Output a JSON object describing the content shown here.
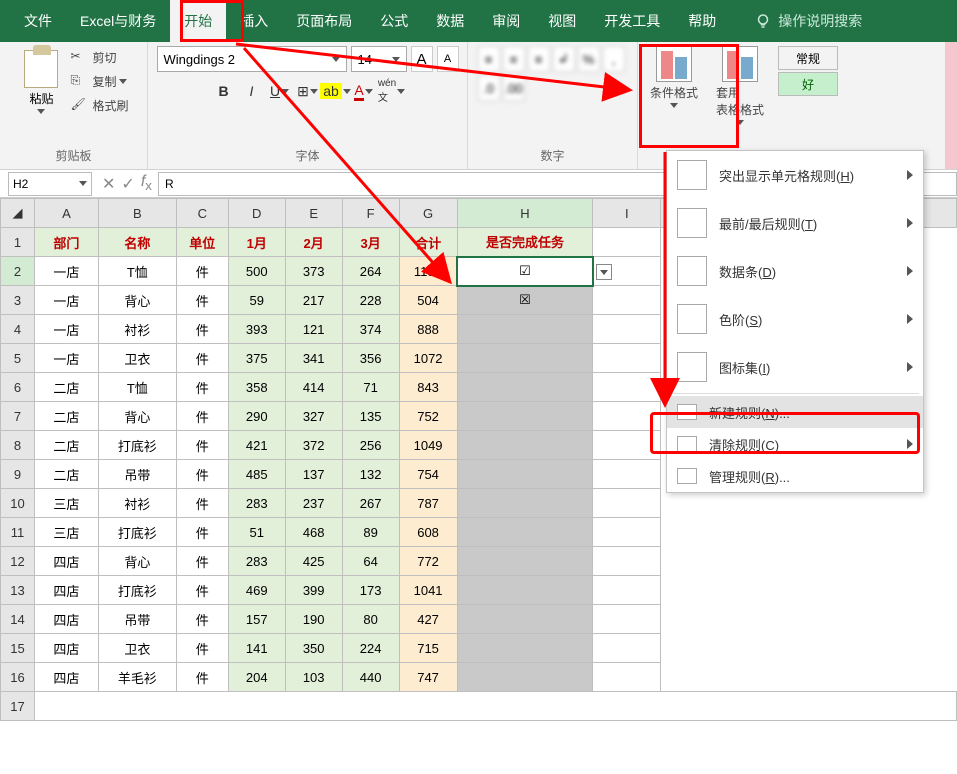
{
  "tabs": [
    "文件",
    "Excel与财务",
    "开始",
    "插入",
    "页面布局",
    "公式",
    "数据",
    "审阅",
    "视图",
    "开发工具",
    "帮助"
  ],
  "activeTab": 2,
  "search": "操作说明搜索",
  "clipboard": {
    "paste": "粘贴",
    "cut": "剪切",
    "copy": "复制",
    "format": "格式刷",
    "group": "剪贴板"
  },
  "font": {
    "group": "字体",
    "name": "Wingdings 2",
    "size": "14",
    "incA": "A",
    "decA": "A"
  },
  "number": {
    "group": "数字"
  },
  "condfmt": {
    "label1": "条件格式",
    "label2": "套用\n表格格式"
  },
  "styles": {
    "s1": "常规",
    "s2": "好"
  },
  "fx": {
    "namebox": "H2",
    "value": "R"
  },
  "columns": [
    "A",
    "B",
    "C",
    "D",
    "E",
    "F",
    "G",
    "H",
    "I"
  ],
  "headers": [
    "部门",
    "名称",
    "单位",
    "1月",
    "2月",
    "3月",
    "合计",
    "是否完成任务"
  ],
  "rows": [
    {
      "r": 2,
      "c": [
        "一店",
        "T恤",
        "件",
        "500",
        "373",
        "264",
        "1137",
        "☑"
      ]
    },
    {
      "r": 3,
      "c": [
        "一店",
        "背心",
        "件",
        "59",
        "217",
        "228",
        "504",
        "☒"
      ]
    },
    {
      "r": 4,
      "c": [
        "一店",
        "衬衫",
        "件",
        "393",
        "121",
        "374",
        "888",
        ""
      ]
    },
    {
      "r": 5,
      "c": [
        "一店",
        "卫衣",
        "件",
        "375",
        "341",
        "356",
        "1072",
        ""
      ]
    },
    {
      "r": 6,
      "c": [
        "二店",
        "T恤",
        "件",
        "358",
        "414",
        "71",
        "843",
        ""
      ]
    },
    {
      "r": 7,
      "c": [
        "二店",
        "背心",
        "件",
        "290",
        "327",
        "135",
        "752",
        ""
      ]
    },
    {
      "r": 8,
      "c": [
        "二店",
        "打底衫",
        "件",
        "421",
        "372",
        "256",
        "1049",
        ""
      ]
    },
    {
      "r": 9,
      "c": [
        "二店",
        "吊带",
        "件",
        "485",
        "137",
        "132",
        "754",
        ""
      ]
    },
    {
      "r": 10,
      "c": [
        "三店",
        "衬衫",
        "件",
        "283",
        "237",
        "267",
        "787",
        ""
      ]
    },
    {
      "r": 11,
      "c": [
        "三店",
        "打底衫",
        "件",
        "51",
        "468",
        "89",
        "608",
        ""
      ]
    },
    {
      "r": 12,
      "c": [
        "四店",
        "背心",
        "件",
        "283",
        "425",
        "64",
        "772",
        ""
      ]
    },
    {
      "r": 13,
      "c": [
        "四店",
        "打底衫",
        "件",
        "469",
        "399",
        "173",
        "1041",
        ""
      ]
    },
    {
      "r": 14,
      "c": [
        "四店",
        "吊带",
        "件",
        "157",
        "190",
        "80",
        "427",
        ""
      ]
    },
    {
      "r": 15,
      "c": [
        "四店",
        "卫衣",
        "件",
        "141",
        "350",
        "224",
        "715",
        ""
      ]
    },
    {
      "r": 16,
      "c": [
        "四店",
        "羊毛衫",
        "件",
        "204",
        "103",
        "440",
        "747",
        ""
      ]
    }
  ],
  "cfmenu": {
    "items": [
      {
        "label": "突出显示单元格规则(H)",
        "arrow": true,
        "icon": "highlight"
      },
      {
        "label": "最前/最后规则(T)",
        "arrow": true,
        "icon": "toprule"
      },
      {
        "label": "数据条(D)",
        "arrow": true,
        "icon": "databar"
      },
      {
        "label": "色阶(S)",
        "arrow": true,
        "icon": "colorscale"
      },
      {
        "label": "图标集(I)",
        "arrow": true,
        "icon": "iconset"
      }
    ],
    "small": [
      {
        "label": "新建规则(N)...",
        "icon": "new",
        "hl": true
      },
      {
        "label": "清除规则(C)",
        "icon": "clear",
        "arrow": true
      },
      {
        "label": "管理规则(R)...",
        "icon": "manage"
      }
    ]
  }
}
